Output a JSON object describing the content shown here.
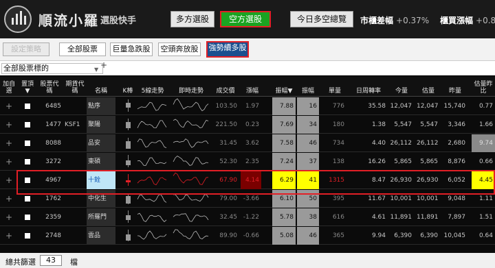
{
  "app": {
    "title": "順流小羅",
    "subtitle": "選股快手"
  },
  "top_buttons": {
    "long": "多方選股",
    "short": "空方選股",
    "overview": "今日多空總覽"
  },
  "tickers": [
    {
      "label": "市櫃差幅",
      "value": "+0.37%"
    },
    {
      "label": "櫃買漲幅",
      "value": "+0.8"
    }
  ],
  "strategy": {
    "set": "設定策略",
    "tabs": [
      "全部股票",
      "巨量急跌股",
      "空頭奔放股",
      "強勢續多股"
    ]
  },
  "filter": {
    "selected": "全部股票標的",
    "add": "+"
  },
  "headers": {
    "add": "加自選",
    "pin": "置頂▼",
    "code": "股票代碼",
    "fut": "期貨代碼",
    "name": "名稱",
    "k": "K棒",
    "s1": "5線走勢",
    "s2": "即時走勢",
    "price": "成交價",
    "chg": "漲幅",
    "amp": "振幅▼",
    "amp2": "振幅",
    "vol1": "單量",
    "turn": "日周轉率",
    "today": "今量",
    "est": "估量",
    "yest": "昨量",
    "ratio": "估量昨比"
  },
  "rows": [
    {
      "code": "6485",
      "fut": "",
      "name": "點序",
      "price": "103.50",
      "chg": "1.97",
      "amp": "7.88",
      "amp2": "16",
      "vol1": "776",
      "turn": "35.58",
      "today": "12,047",
      "est": "12,047",
      "yest": "15,740",
      "ratio": "0.77"
    },
    {
      "code": "1477",
      "fut": "KSF1",
      "name": "聚陽",
      "price": "221.50",
      "chg": "0.23",
      "amp": "7.69",
      "amp2": "34",
      "vol1": "180",
      "turn": "1.38",
      "today": "5,547",
      "est": "5,547",
      "yest": "3,346",
      "ratio": "1.66"
    },
    {
      "code": "8088",
      "fut": "",
      "name": "品安",
      "price": "31.45",
      "chg": "3.62",
      "amp": "7.58",
      "amp2": "46",
      "vol1": "734",
      "turn": "4.40",
      "today": "26,112",
      "est": "26,112",
      "yest": "2,680",
      "ratio": "9.74"
    },
    {
      "code": "3272",
      "fut": "",
      "name": "東碩",
      "price": "52.30",
      "chg": "2.35",
      "amp": "7.24",
      "amp2": "37",
      "vol1": "138",
      "turn": "16.26",
      "today": "5,865",
      "est": "5,865",
      "yest": "8,876",
      "ratio": "0.66"
    },
    {
      "code": "4967",
      "fut": "",
      "name": "十銓",
      "price": "67.90",
      "chg": "4.14",
      "amp": "6.29",
      "amp2": "41",
      "vol1": "1315",
      "turn": "8.47",
      "today": "26,930",
      "est": "26,930",
      "yest": "6,052",
      "ratio": "4.45"
    },
    {
      "code": "1762",
      "fut": "",
      "name": "中化生",
      "price": "79.00",
      "chg": "-3.66",
      "amp": "6.10",
      "amp2": "50",
      "vol1": "395",
      "turn": "11.67",
      "today": "10,001",
      "est": "10,001",
      "yest": "9,048",
      "ratio": "1.11"
    },
    {
      "code": "2359",
      "fut": "",
      "name": "所羅門",
      "price": "32.45",
      "chg": "-1.22",
      "amp": "5.78",
      "amp2": "38",
      "vol1": "616",
      "turn": "4.61",
      "today": "11,891",
      "est": "11,891",
      "yest": "7,897",
      "ratio": "1.51"
    },
    {
      "code": "2748",
      "fut": "",
      "name": "雲品",
      "price": "89.90",
      "chg": "-0.66",
      "amp": "5.08",
      "amp2": "46",
      "vol1": "365",
      "turn": "9.94",
      "today": "6,390",
      "est": "6,390",
      "yest": "10,045",
      "ratio": "0.64"
    }
  ],
  "footer": {
    "label": "總共篩選",
    "count": "43",
    "unit": "檔"
  },
  "colors": {
    "accent_red": "#e21f26",
    "short_green": "#1aa321",
    "highlight_yellow": "#ffff00",
    "selected_name_bg": "#bfe6f7"
  }
}
